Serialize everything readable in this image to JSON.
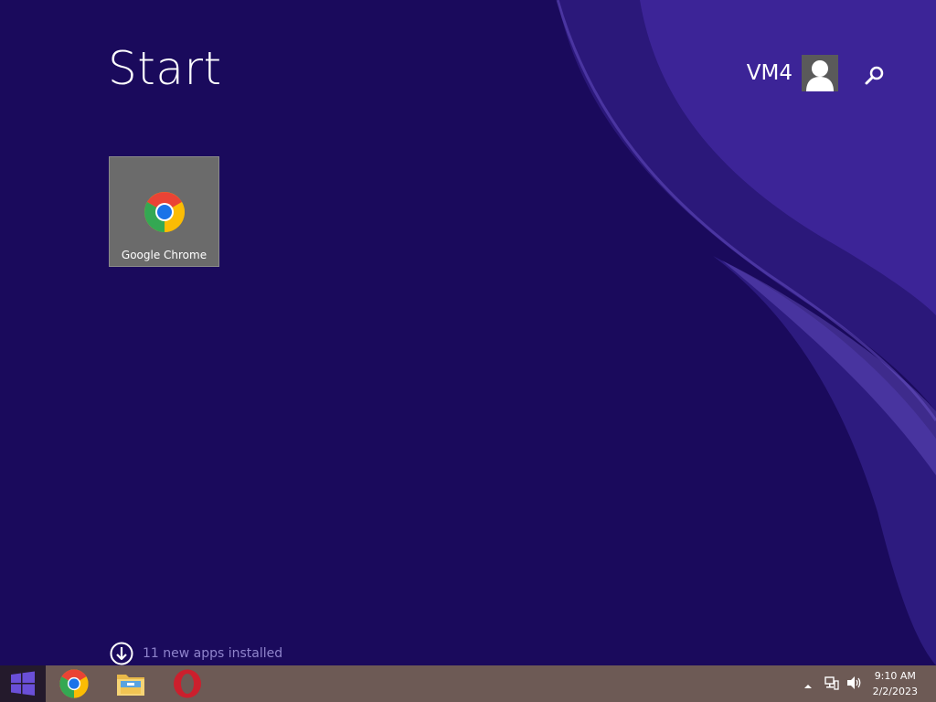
{
  "screen": {
    "title": "Start",
    "background_color": "#1a0a5c",
    "accent_color": "#8f84cc"
  },
  "user": {
    "name": "VM4",
    "avatar_icon": "user-silhouette-icon"
  },
  "search": {
    "icon": "search-icon"
  },
  "tiles": [
    {
      "label": "Google Chrome",
      "icon": "chrome-icon",
      "tile_color": "#6b6b6b"
    }
  ],
  "notification": {
    "text": "11 new apps installed",
    "icon": "arrow-down-circle-icon"
  },
  "taskbar": {
    "start_icon": "windows-logo-icon",
    "pinned_apps": [
      {
        "name": "Google Chrome",
        "icon": "chrome-icon"
      },
      {
        "name": "File Explorer",
        "icon": "folder-icon"
      },
      {
        "name": "Opera",
        "icon": "opera-icon"
      }
    ],
    "tray_icons": [
      "show-hidden-icons-chevron-icon",
      "network-icon",
      "volume-icon"
    ],
    "clock": {
      "time": "9:10 AM",
      "date": "2/2/2023"
    }
  }
}
